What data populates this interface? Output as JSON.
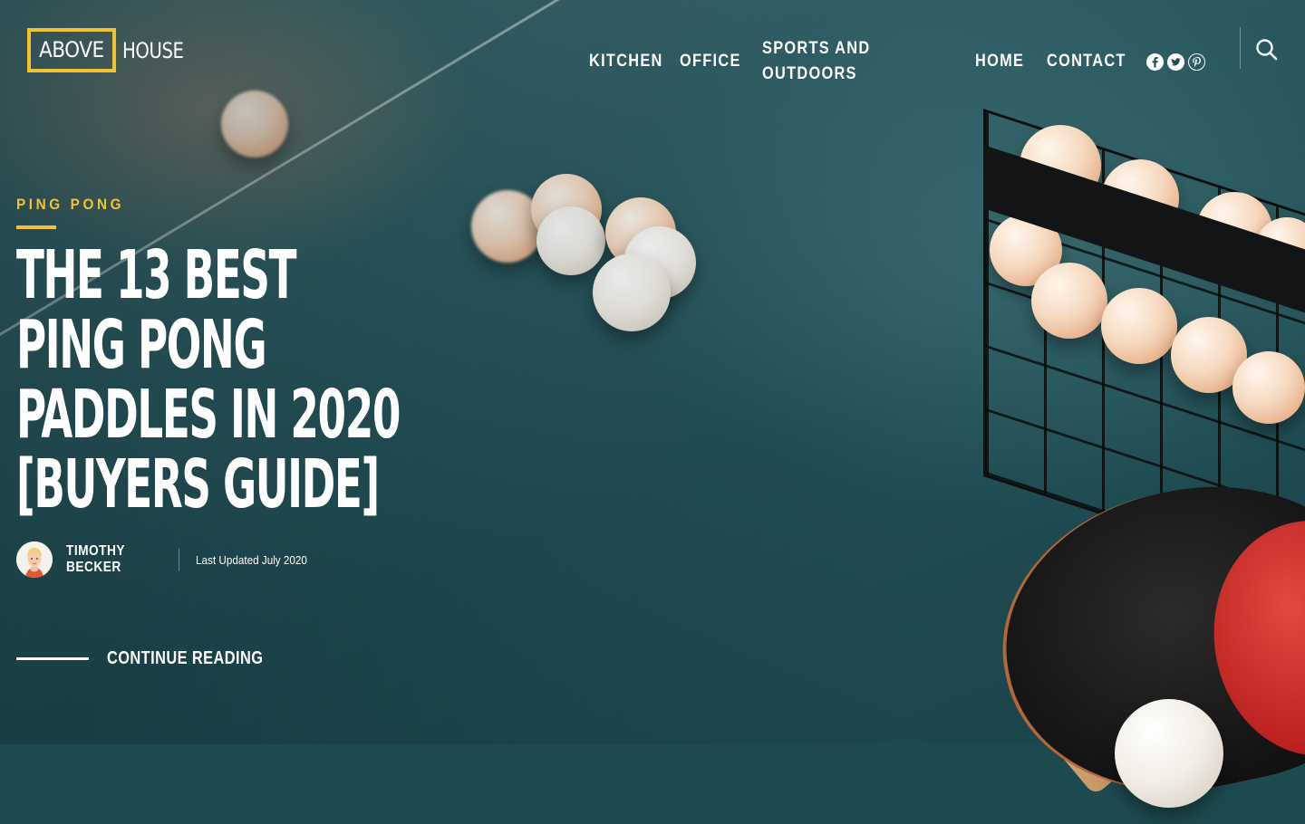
{
  "header": {
    "logo": {
      "boxed": "ABOVE",
      "text": "HOUSE"
    },
    "nav": [
      {
        "label": "KITCHEN"
      },
      {
        "label": "OFFICE"
      },
      {
        "label": "SPORTS AND OUTDOORS"
      },
      {
        "label": "HOME"
      },
      {
        "label": "CONTACT"
      }
    ],
    "social": [
      {
        "icon": "facebook-icon",
        "glyph": "f"
      },
      {
        "icon": "twitter-icon",
        "glyph": "t"
      },
      {
        "icon": "pinterest-icon",
        "glyph": "p"
      }
    ],
    "search_icon": "search-icon"
  },
  "hero": {
    "category": "PING PONG",
    "headline": "THE 13 BEST PING PONG PADDLES IN 2020 [BUYERS GUIDE]",
    "author": "TIMOTHY BECKER",
    "updated": "Last Updated July 2020",
    "cta": "CONTINUE READING"
  },
  "colors": {
    "accent": "#f2c232",
    "background": "#1f4d53",
    "text": "#ffffff"
  }
}
